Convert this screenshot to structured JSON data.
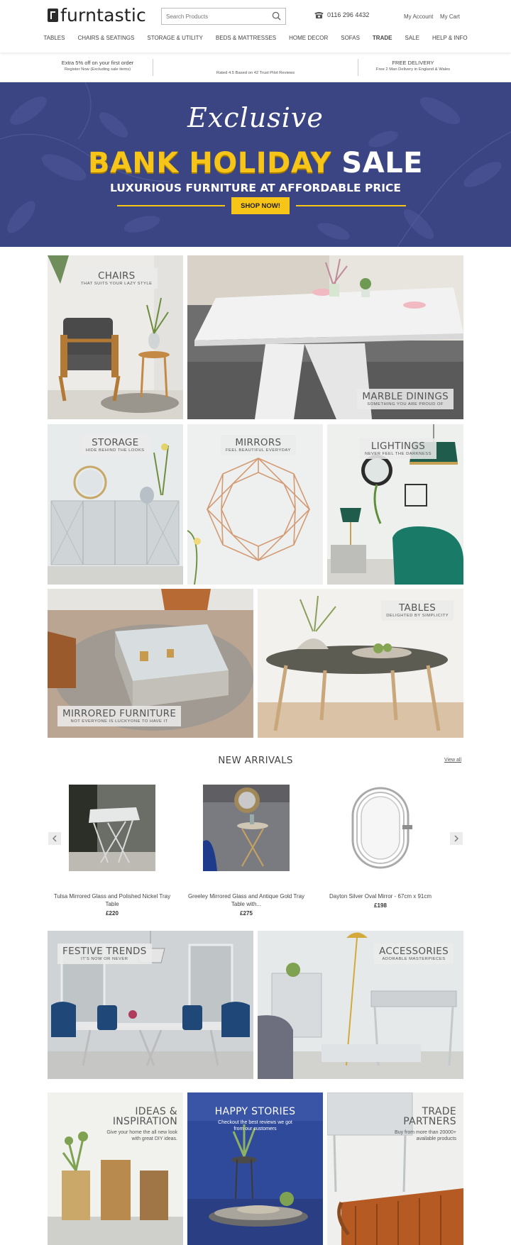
{
  "header": {
    "logo_text": "furntastic",
    "search_placeholder": "Search Products",
    "phone": "0116 296 4432",
    "my_account": "My Account",
    "my_cart": "My Cart"
  },
  "nav": [
    "TABLES",
    "CHAIRS & SEATINGS",
    "STORAGE & UTILITY",
    "BEDS & MATTRESSES",
    "HOME DECOR",
    "SOFAS",
    "TRADE",
    "SALE",
    "HELP & INFO"
  ],
  "info": {
    "left_title": "Extra 5% off on your first order",
    "left_sub": "Register Now (Excluding sale items)",
    "center_sub": "Rated 4.5 Based on 42 Trust Pilot Reviews",
    "right_title": "FREE DELIVERY",
    "right_sub": "Free 2 Man Delivery in England & Wales"
  },
  "hero": {
    "script": "Exclusive",
    "title_yellow": "BANK HOLIDAY",
    "title_white": "SALE",
    "subtitle": "LUXURIOUS FURNITURE AT AFFORDABLE PRICE",
    "button": "SHOP NOW!"
  },
  "tiles": {
    "chairs": {
      "title": "CHAIRS",
      "sub": "THAT SUITS YOUR LAZY STYLE"
    },
    "marble": {
      "title": "MARBLE DININGS",
      "sub": "SOMETHING YOU ARE PROUD OF"
    },
    "storage": {
      "title": "STORAGE",
      "sub": "HIDE BEHIND THE LOOKS"
    },
    "mirrors": {
      "title": "MIRRORS",
      "sub": "FEEL BEAUTIFUL EVERYDAY"
    },
    "lightings": {
      "title": "LIGHTINGS",
      "sub": "NEVER FEEL THE DARKNESS"
    },
    "mirrored": {
      "title": "MIRRORED FURNITURE",
      "sub": "NOT EVERYONE IS LUCKYONE TO HAVE IT"
    },
    "tables": {
      "title": "TABLES",
      "sub": "DELIGHTED BY SIMPLICITY"
    },
    "festive": {
      "title": "FESTIVE TRENDS",
      "sub": "IT'S NOW OR NEVER"
    },
    "accessories": {
      "title": "ACCESSORIES",
      "sub": "ADORABLE MASTERPIECES"
    }
  },
  "new_arrivals": {
    "title": "NEW ARRIVALS",
    "view_all": "View all",
    "products": [
      {
        "name": "Tulsa Mirrored Glass and Polished Nickel Tray Table",
        "price": "£220"
      },
      {
        "name": "Greeley Mirrored Glass and Antique Gold Tray Table with...",
        "price": "£275"
      },
      {
        "name": "Dayton Silver Oval Mirror - 67cm x 91cm",
        "price": "£198"
      }
    ]
  },
  "promos": {
    "ideas": {
      "title_1": "IDEAS &",
      "title_2": "INSPIRATION",
      "desc_1": "Give your home the all new look",
      "desc_2": "with great DIY ideas."
    },
    "stories": {
      "title": "HAPPY STORIES",
      "desc_1": "Checkout the best reviews we got",
      "desc_2": "from our customers"
    },
    "trade": {
      "title_1": "TRADE",
      "title_2": "PARTNERS",
      "desc_1": "Buy from more than 20000+",
      "desc_2": "available products"
    }
  },
  "colors": {
    "hero_bg": "#3c4584",
    "hero_accent": "#f7c518",
    "stories_bg": "#2f4a9a"
  }
}
